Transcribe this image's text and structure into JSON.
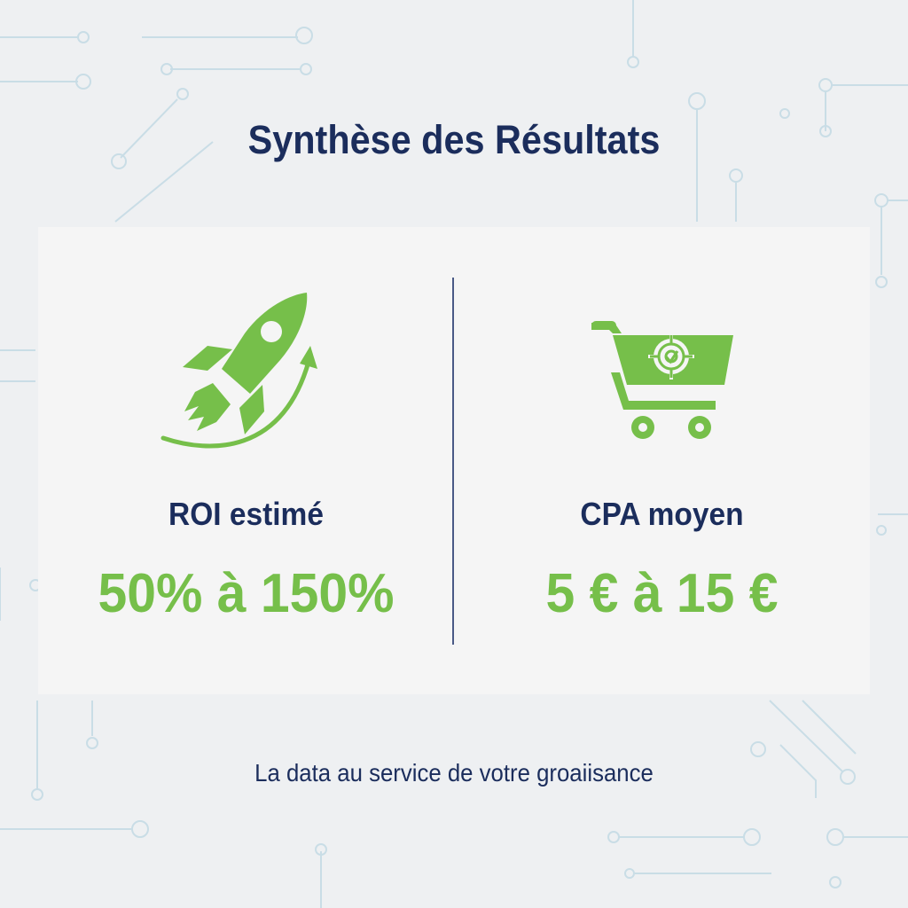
{
  "title": "Synthèse des Résultats",
  "metrics": [
    {
      "icon": "rocket-icon",
      "label": "ROI estimé",
      "value": "50% à 150%"
    },
    {
      "icon": "shopping-cart-target-icon",
      "label": "CPA moyen",
      "value": "5 € à 15 €"
    }
  ],
  "tagline": "La data au service de votre groaiisance",
  "colors": {
    "accent_green": "#76bf4a",
    "navy": "#1b2d5c",
    "background": "#eef0f2",
    "card": "#f5f5f5"
  }
}
